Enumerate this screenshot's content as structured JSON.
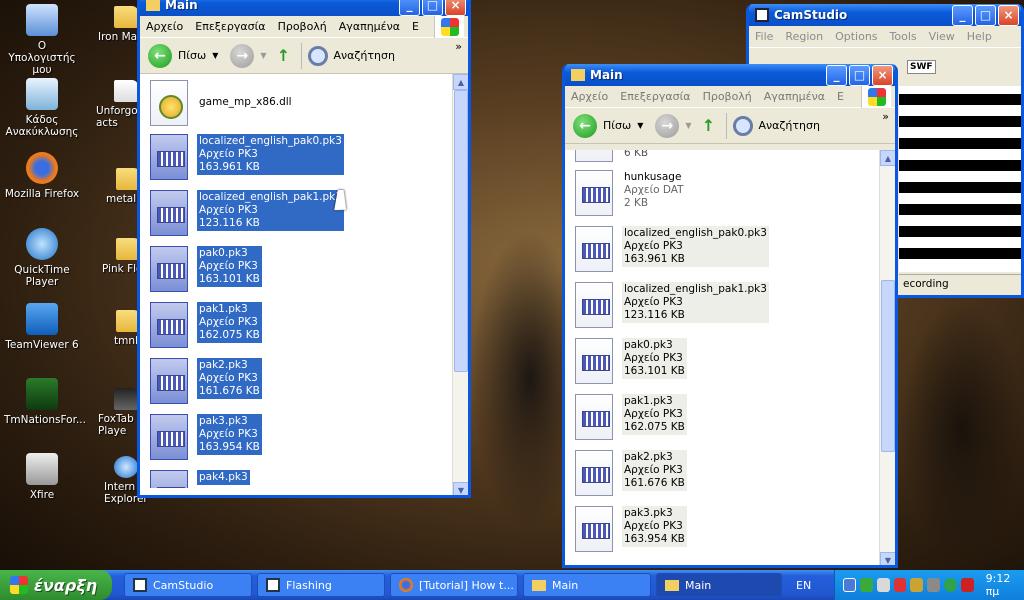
{
  "desktop": {
    "icons_left": [
      {
        "label": "Ο Υπολογιστής μου",
        "icon": "my-computer-icon"
      },
      {
        "label": "Κάδος Ανακύκλωσης",
        "icon": "recycle-bin-icon"
      },
      {
        "label": "Mozilla Firefox",
        "icon": "firefox-icon"
      },
      {
        "label": "QuickTime Player",
        "icon": "quicktime-icon"
      },
      {
        "label": "TeamViewer 6",
        "icon": "teamviewer-icon"
      },
      {
        "label": "TmNationsFor...",
        "icon": "tmnations-icon"
      },
      {
        "label": "Xfire",
        "icon": "xfire-icon"
      }
    ],
    "icons_col2": [
      {
        "label": "Iron Ma"
      },
      {
        "label": "Unforgo acts"
      },
      {
        "label": "metall"
      },
      {
        "label": "Pink Flo"
      },
      {
        "label": "tmnl"
      },
      {
        "label": "FoxTab Playe"
      },
      {
        "label": "Intern Explorer"
      }
    ]
  },
  "window1": {
    "title": "Main",
    "menu": [
      "Αρχείο",
      "Επεξεργασία",
      "Προβολή",
      "Αγαπημένα",
      "Ε"
    ],
    "toolbar": {
      "back": "Πίσω",
      "search": "Αναζήτηση"
    },
    "files": [
      {
        "name": "game_mp_x86.dll",
        "type": "",
        "size": "",
        "selected": false,
        "kind": "dll"
      },
      {
        "name": "localized_english_pak0.pk3",
        "type": "Αρχείο PK3",
        "size": "163.961 KB",
        "selected": true
      },
      {
        "name": "localized_english_pak1.pk3",
        "type": "Αρχείο PK3",
        "size": "123.116 KB",
        "selected": true
      },
      {
        "name": "pak0.pk3",
        "type": "Αρχείο PK3",
        "size": "163.101 KB",
        "selected": true
      },
      {
        "name": "pak1.pk3",
        "type": "Αρχείο PK3",
        "size": "162.075 KB",
        "selected": true
      },
      {
        "name": "pak2.pk3",
        "type": "Αρχείο PK3",
        "size": "161.676 KB",
        "selected": true
      },
      {
        "name": "pak3.pk3",
        "type": "Αρχείο PK3",
        "size": "163.954 KB",
        "selected": true
      },
      {
        "name": "pak4.pk3",
        "type": "",
        "size": "",
        "selected": true
      }
    ]
  },
  "window2": {
    "title": "Main",
    "menu": [
      "Αρχείο",
      "Επεξεργασία",
      "Προβολή",
      "Αγαπημένα",
      "Ε"
    ],
    "toolbar": {
      "back": "Πίσω",
      "search": "Αναζήτηση"
    },
    "partial_top": "6 KB",
    "files": [
      {
        "name": "hunkusage",
        "type": "Αρχείο DAT",
        "size": "2 KB",
        "highlight": false
      },
      {
        "name": "localized_english_pak0.pk3",
        "type": "Αρχείο PK3",
        "size": "163.961 KB",
        "highlight": true
      },
      {
        "name": "localized_english_pak1.pk3",
        "type": "Αρχείο PK3",
        "size": "123.116 KB",
        "highlight": true
      },
      {
        "name": "pak0.pk3",
        "type": "Αρχείο PK3",
        "size": "163.101 KB",
        "highlight": true
      },
      {
        "name": "pak1.pk3",
        "type": "Αρχείο PK3",
        "size": "162.075 KB",
        "highlight": true
      },
      {
        "name": "pak2.pk3",
        "type": "Αρχείο PK3",
        "size": "161.676 KB",
        "highlight": true
      },
      {
        "name": "pak3.pk3",
        "type": "Αρχείο PK3",
        "size": "163.954 KB",
        "highlight": true
      }
    ]
  },
  "camstudio": {
    "title": "CamStudio",
    "menu": [
      "File",
      "Region",
      "Options",
      "Tools",
      "View",
      "Help"
    ],
    "tool_label": "SWF",
    "status": "ecording"
  },
  "taskbar": {
    "start_label": "έναρξη",
    "tasks": [
      {
        "label": "CamStudio",
        "active": false
      },
      {
        "label": "Flashing",
        "active": false
      },
      {
        "label": "[Tutorial] How t...",
        "active": false
      },
      {
        "label": "Main",
        "active": false
      },
      {
        "label": "Main",
        "active": true
      }
    ],
    "lang": "EN",
    "clock": "9:12 πμ"
  }
}
